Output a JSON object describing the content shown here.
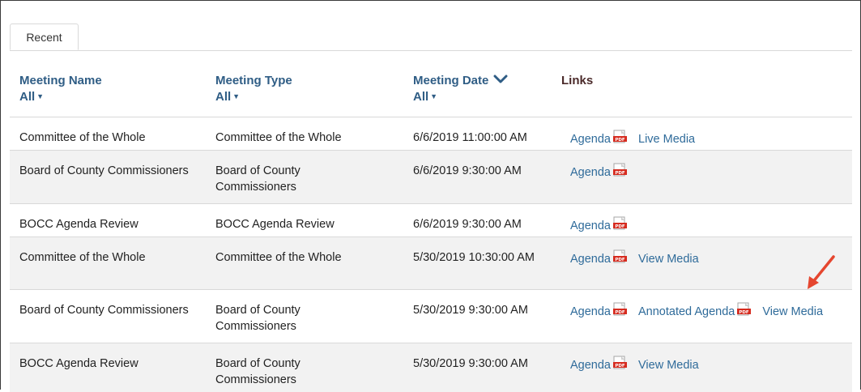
{
  "tabs": [
    {
      "label": "Recent"
    }
  ],
  "headers": {
    "name": {
      "label": "Meeting Name",
      "filter": "All"
    },
    "type": {
      "label": "Meeting Type",
      "filter": "All"
    },
    "date": {
      "label": "Meeting Date",
      "filter": "All"
    },
    "links": {
      "label": "Links"
    }
  },
  "rows": [
    {
      "name": "Committee of the Whole",
      "type": "Committee of the Whole",
      "date": "6/6/2019 11:00:00 AM",
      "links": [
        {
          "label": "Agenda",
          "pdf": true
        },
        {
          "label": "Live Media",
          "pdf": false
        }
      ]
    },
    {
      "name": "Board of County Commissioners",
      "type": "Board of County Commissioners",
      "date": "6/6/2019 9:30:00 AM",
      "links": [
        {
          "label": "Agenda",
          "pdf": true
        }
      ]
    },
    {
      "name": "BOCC Agenda Review",
      "type": "BOCC Agenda Review",
      "date": "6/6/2019 9:30:00 AM",
      "links": [
        {
          "label": "Agenda",
          "pdf": true
        }
      ]
    },
    {
      "name": "Committee of the Whole",
      "type": "Committee of the Whole",
      "date": "5/30/2019 10:30:00 AM",
      "links": [
        {
          "label": "Agenda",
          "pdf": true
        },
        {
          "label": "View Media",
          "pdf": false
        }
      ]
    },
    {
      "name": "Board of County Commissioners",
      "type": "Board of County Commissioners",
      "date": "5/30/2019 9:30:00 AM",
      "links": [
        {
          "label": "Agenda",
          "pdf": true
        },
        {
          "label": "Annotated Agenda",
          "pdf": true
        },
        {
          "label": "View Media",
          "pdf": false
        }
      ]
    },
    {
      "name": "BOCC Agenda Review",
      "type": "Board of County Commissioners",
      "date": "5/30/2019 9:30:00 AM",
      "links": [
        {
          "label": "Agenda",
          "pdf": true
        },
        {
          "label": "View Media",
          "pdf": false
        }
      ]
    }
  ],
  "icons": {
    "pdf": "pdf-icon",
    "sort": "chevron-down-icon",
    "annotation": "red-arrow-icon"
  },
  "colors": {
    "link": "#2f6b9a",
    "header": "#2f5d85",
    "pdf": "#d62b1f",
    "arrow": "#e5462f"
  }
}
